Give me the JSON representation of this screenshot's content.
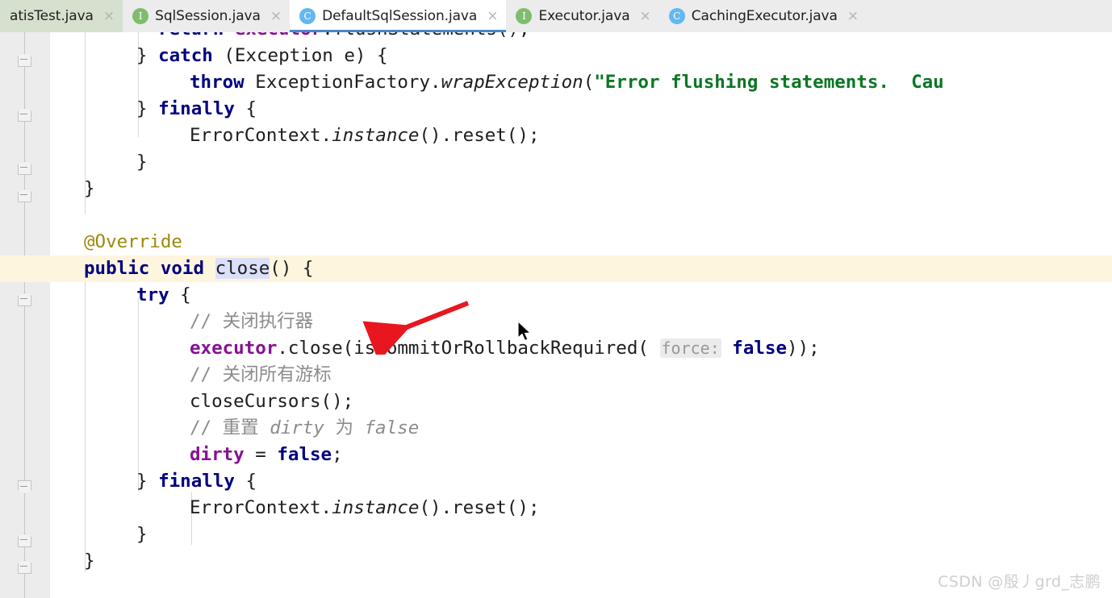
{
  "window": {
    "app": "IntelliJ IDEA editor",
    "watermark": "CSDN @殷丿grd_志鹏"
  },
  "tabbar": {
    "tabs": [
      {
        "label": "atisTest.java",
        "icon": "",
        "icon_kind": "none",
        "state": "green",
        "close": "×"
      },
      {
        "label": "SqlSession.java",
        "icon": "I",
        "icon_kind": "interface",
        "state": "plain",
        "close": "×"
      },
      {
        "label": "DefaultSqlSession.java",
        "icon": "C",
        "icon_kind": "class",
        "state": "active",
        "close": "×"
      },
      {
        "label": "Executor.java",
        "icon": "I",
        "icon_kind": "interface",
        "state": "plain",
        "close": "×"
      },
      {
        "label": "CachingExecutor.java",
        "icon": "C",
        "icon_kind": "class",
        "state": "plain",
        "close": "×"
      }
    ]
  },
  "editor": {
    "language": "java",
    "highlighted_line_index": 8,
    "caret_line": "public void close() {",
    "selected_word": "close",
    "inlay_hint": "force:",
    "lines": [
      {
        "n": 0,
        "indent": 4,
        "tokens": "return executor.flushStatements();",
        "cut_top": true
      },
      {
        "n": 1,
        "indent": 2,
        "tokens": "} catch (Exception e) {"
      },
      {
        "n": 2,
        "indent": 3,
        "tokens": "throw ExceptionFactory.wrapException(\"Error flushing statements.  Cau"
      },
      {
        "n": 3,
        "indent": 2,
        "tokens": "} finally {"
      },
      {
        "n": 4,
        "indent": 3,
        "tokens": "ErrorContext.instance().reset();"
      },
      {
        "n": 5,
        "indent": 2,
        "tokens": "}"
      },
      {
        "n": 6,
        "indent": 1,
        "tokens": "}"
      },
      {
        "n": 7,
        "indent": 0,
        "tokens": ""
      },
      {
        "n": 8,
        "indent": 1,
        "tokens": "@Override"
      },
      {
        "n": 9,
        "indent": 1,
        "tokens": "public void close() {"
      },
      {
        "n": 10,
        "indent": 2,
        "tokens": "try {"
      },
      {
        "n": 11,
        "indent": 3,
        "tokens": "// 关闭执行器"
      },
      {
        "n": 12,
        "indent": 3,
        "tokens": "executor.close(isCommitOrRollbackRequired( force: false));"
      },
      {
        "n": 13,
        "indent": 3,
        "tokens": "// 关闭所有游标"
      },
      {
        "n": 14,
        "indent": 3,
        "tokens": "closeCursors();"
      },
      {
        "n": 15,
        "indent": 3,
        "tokens": "// 重置 dirty 为 false"
      },
      {
        "n": 16,
        "indent": 3,
        "tokens": "dirty = false;"
      },
      {
        "n": 17,
        "indent": 2,
        "tokens": "} finally {"
      },
      {
        "n": 18,
        "indent": 3,
        "tokens": "ErrorContext.instance().reset();"
      },
      {
        "n": 19,
        "indent": 2,
        "tokens": "}"
      },
      {
        "n": 20,
        "indent": 1,
        "tokens": "}"
      }
    ],
    "text_fragments": {
      "l0_kw_return": "return",
      "l0_field": "executor",
      "l0_call": ".flushStatements();",
      "l1_brace": "} ",
      "l1_kw": "catch",
      "l1_rest": " (Exception e) {",
      "l2_kw": "throw",
      "l2_cls": " ExceptionFactory.",
      "l2_method": "wrapException",
      "l2_paren": "(",
      "l2_str": "\"Error flushing statements.  Cau",
      "l3_brace": "} ",
      "l3_kw": "finally",
      "l3_rest": " {",
      "l4_text": "ErrorContext.",
      "l4_static": "instance",
      "l4_rest": "().reset();",
      "l5_text": "}",
      "l6_text": "}",
      "l8_anno": "@Override",
      "l9_kw1": "public",
      "l9_kw2": "void",
      "l9_name": "close",
      "l9_rest": "() {",
      "l10_kw": "try",
      "l10_rest": " {",
      "l11_cmt": "// 关闭执行器",
      "l12_field": "executor",
      "l12_call": ".close(isCommitOrRollbackRequired(",
      "l12_hint": "force:",
      "l12_kw": "false",
      "l12_tail": "));",
      "l13_cmt": "// 关闭所有游标",
      "l14_text": "closeCursors();",
      "l15_cmt_a": "// 重置 ",
      "l15_cmt_b": "dirty",
      "l15_cmt_c": " 为 ",
      "l15_cmt_d": "false",
      "l16_field": "dirty",
      "l16_op": " = ",
      "l16_kw": "false",
      "l16_semi": ";",
      "l17_brace": "} ",
      "l17_kw": "finally",
      "l17_rest": " {",
      "l18_text": "ErrorContext.",
      "l18_static": "instance",
      "l18_rest": "().reset();",
      "l19_text": "}",
      "l20_text": "}"
    }
  },
  "annotations": {
    "red_arrow": "red-arrow-pointing-to-executor-close-line",
    "mouse_cursor": "mouse-pointer"
  },
  "colors": {
    "tab_active_bg": "#ffffff",
    "tab_green_bg": "#d6e0cf",
    "tab_bar_bg": "#ececec",
    "tab_underline": "#4a86c8",
    "gutter_bg": "#ececec",
    "caret_line_bg": "#fdf5dd",
    "keyword": "#000080",
    "string": "#0a7723",
    "comment": "#8c8c8c",
    "field": "#871094",
    "annotation": "#9e880d",
    "selection": "#dcdffa",
    "arrow_red": "#e8171f",
    "watermark": "#cfcfcf"
  }
}
